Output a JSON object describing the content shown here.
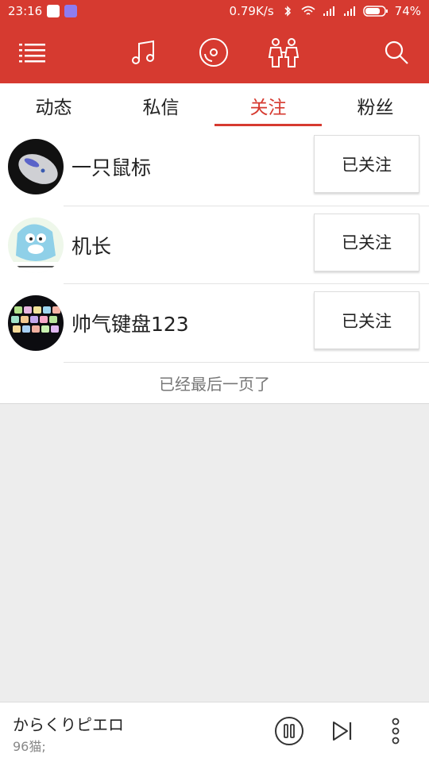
{
  "status_bar": {
    "time": "23:16",
    "network_speed": "0.79K/s",
    "battery": "74%"
  },
  "app_bar": {
    "icons": [
      "menu-icon",
      "music-note-icon",
      "disc-icon",
      "friends-icon",
      "search-icon"
    ]
  },
  "tabs": [
    {
      "label": "动态",
      "active": false
    },
    {
      "label": "私信",
      "active": false
    },
    {
      "label": "关注",
      "active": true
    },
    {
      "label": "粉丝",
      "active": false
    }
  ],
  "follow_list": [
    {
      "name": "一只鼠标",
      "button_label": "已关注"
    },
    {
      "name": "机长",
      "button_label": "已关注"
    },
    {
      "name": "帅气键盘123",
      "button_label": "已关注"
    }
  ],
  "end_note": "已经最后一页了",
  "player": {
    "song_title": "からくりピエロ",
    "artist": "96猫;"
  },
  "colors": {
    "accent": "#d63a30",
    "background": "#ededed"
  }
}
